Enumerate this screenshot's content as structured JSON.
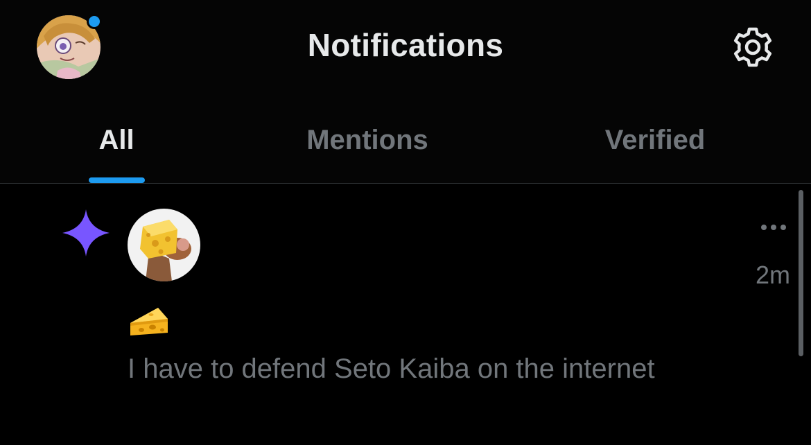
{
  "header": {
    "title": "Notifications",
    "avatar_icon": "user-avatar",
    "settings_icon": "gear-icon",
    "unread_dot_color": "#1d9bf0"
  },
  "tabs": [
    {
      "label": "All",
      "active": true
    },
    {
      "label": "Mentions",
      "active": false
    },
    {
      "label": "Verified",
      "active": false
    }
  ],
  "accent_color": "#1d9bf0",
  "notification": {
    "type_icon": "sparkle-icon",
    "type_icon_color": "#7856ff",
    "avatar_icon": "cheese-mouse-avatar",
    "more_icon": "more-horizontal-icon",
    "time": "2m",
    "emoji_icon": "cheese-wedge-icon",
    "text": "I have to defend Seto Kaiba on the internet"
  }
}
